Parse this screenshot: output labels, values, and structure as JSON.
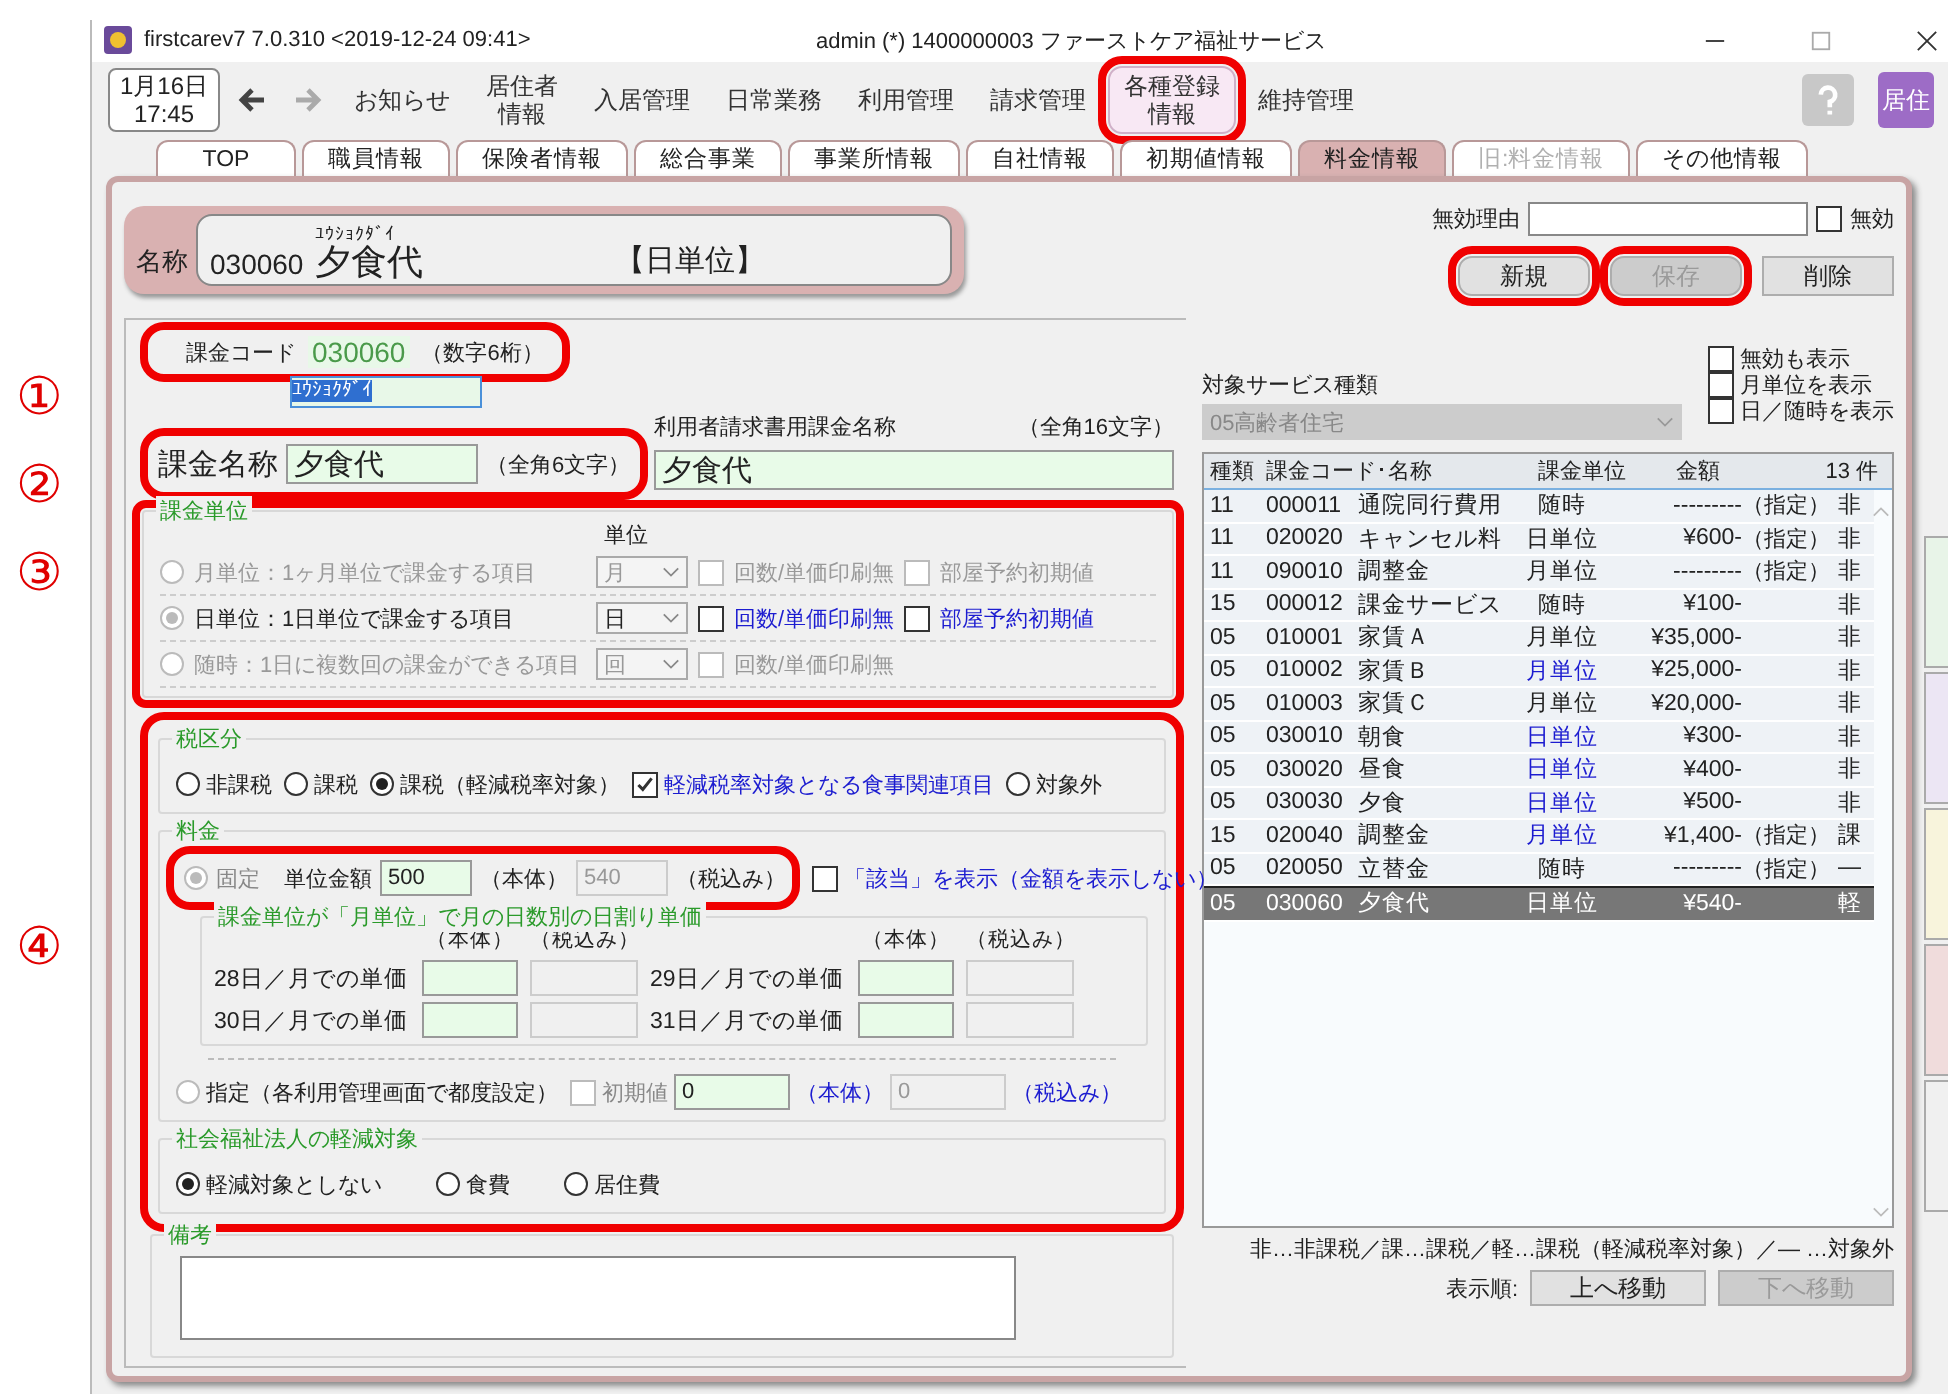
{
  "window": {
    "title": "firstcarev7 7.0.310 <2019-12-24 09:41>",
    "account": "admin (*) 1400000003 ファーストケア福祉サービス"
  },
  "date": {
    "day": "1月16日",
    "time": "17:45"
  },
  "nav": [
    {
      "label": "お知らせ",
      "selected": false
    },
    {
      "lines": [
        "居住者",
        "情報"
      ],
      "selected": false
    },
    {
      "label": "入居管理",
      "selected": false
    },
    {
      "label": "日常業務",
      "selected": false
    },
    {
      "label": "利用管理",
      "selected": false
    },
    {
      "label": "請求管理",
      "selected": false
    },
    {
      "lines": [
        "各種登録",
        "情報"
      ],
      "selected": true,
      "highlighted": true
    },
    {
      "label": "維持管理",
      "selected": false
    }
  ],
  "nav_side_button": "居住",
  "tabs": [
    {
      "label": "TOP",
      "selected": false,
      "disabled": false
    },
    {
      "label": "職員情報",
      "selected": false,
      "disabled": false
    },
    {
      "label": "保険者情報",
      "selected": false,
      "disabled": false
    },
    {
      "label": "総合事業",
      "selected": false,
      "disabled": false
    },
    {
      "label": "事業所情報",
      "selected": false,
      "disabled": false
    },
    {
      "label": "自社情報",
      "selected": false,
      "disabled": false
    },
    {
      "label": "初期値情報",
      "selected": false,
      "disabled": false
    },
    {
      "label": "料金情報",
      "selected": true,
      "disabled": false
    },
    {
      "label": "旧:料金情報",
      "selected": false,
      "disabled": true
    },
    {
      "label": "その他情報",
      "selected": false,
      "disabled": false
    }
  ],
  "annotations": [
    "①",
    "②",
    "③",
    "④"
  ],
  "header": {
    "label": "名称",
    "code": "030060",
    "kana": "ﾕｳｼｮｸﾀﾞｲ",
    "name": "夕食代",
    "unit": "【日単位】"
  },
  "invalid": {
    "label": "無効理由",
    "check_label": "無効",
    "checked": false
  },
  "buttons": [
    {
      "label": "新規",
      "disabled": false,
      "highlighted": true
    },
    {
      "label": "保存",
      "disabled": true,
      "highlighted": true
    },
    {
      "label": "削除",
      "disabled": false,
      "highlighted": false
    }
  ],
  "code_row": {
    "label": "課金コード",
    "value": "030060",
    "hint": "（数字6桁）",
    "highlighted": true
  },
  "kana_field": "ﾕｳｼｮｸﾀﾞｲ",
  "name_row": {
    "label": "課金名称",
    "value": "夕食代",
    "hint": "（全角6文字）",
    "highlighted": true
  },
  "invoice_name": {
    "label": "利用者請求書用課金名称",
    "hint": "（全角16文字）",
    "value": "夕食代"
  },
  "billing_unit": {
    "title": "課金単位",
    "column": "単位",
    "highlighted": true,
    "rows": [
      {
        "label": "月単位：1ヶ月単位で課金する項目",
        "selected": false,
        "disabled": true,
        "unit": "月",
        "print_label": "回数/単価印刷無",
        "print_checked": false,
        "room_label": "部屋予約初期値",
        "room_checked": false
      },
      {
        "label": "日単位：1日単位で課金する項目",
        "selected": true,
        "disabled": false,
        "unit": "日",
        "print_label": "回数/単価印刷無",
        "print_checked": false,
        "room_label": "部屋予約初期値",
        "room_checked": false
      },
      {
        "label": "随時：1日に複数回の課金ができる項目",
        "selected": false,
        "disabled": true,
        "unit": "回",
        "print_label": "回数/単価印刷無",
        "print_checked": false
      }
    ]
  },
  "pricing_highlighted": true,
  "tax": {
    "title": "税区分",
    "options": [
      {
        "kind": "radio",
        "label": "非課税",
        "selected": false
      },
      {
        "kind": "radio",
        "label": "課税",
        "selected": false
      },
      {
        "kind": "radio",
        "label": "課税（軽減税率対象）",
        "selected": true
      },
      {
        "kind": "checkbox",
        "label": "軽減税率対象となる食事関連項目",
        "checked": true
      },
      {
        "kind": "radio",
        "label": "対象外",
        "selected": false
      }
    ]
  },
  "fee": {
    "title": "料金",
    "fixed": {
      "label": "固定",
      "selected": true,
      "unit_label": "単位金額",
      "value": "500",
      "body": "（本体）",
      "tax_value": "540",
      "tax_in": "（税込み）",
      "highlighted": true
    },
    "show_applicable": {
      "label": "「該当」を表示（金額を表示しない）",
      "checked": false
    },
    "daily": {
      "title": "課金単位が「月単位」で月の日数別の日割り単価",
      "headers": [
        "（本体）",
        "（税込み）",
        "（本体）",
        "（税込み）"
      ],
      "rows": [
        "28日／月での単価",
        "29日／月での単価",
        "30日／月での単価",
        "31日／月での単価"
      ]
    },
    "designated": {
      "label": "指定（各利用管理画面で都度設定）",
      "selected": false,
      "initial_label": "初期値",
      "initial_checked": false,
      "body_value": "0",
      "body": "（本体）",
      "tax_value": "0",
      "tax_in": "（税込み）"
    }
  },
  "reduction": {
    "title": "社会福祉法人の軽減対象",
    "options": [
      {
        "label": "軽減対象としない",
        "selected": true
      },
      {
        "label": "食費",
        "selected": false
      },
      {
        "label": "居住費",
        "selected": false
      }
    ]
  },
  "remarks": {
    "title": "備考"
  },
  "service": {
    "label": "対象サービス種類",
    "value": "05高齢者住宅",
    "filters": [
      {
        "label": "無効も表示",
        "checked": false
      },
      {
        "label": "月単位を表示",
        "checked": false
      },
      {
        "label": "日／随時を表示",
        "checked": false
      }
    ]
  },
  "table": {
    "columns": [
      "種類",
      "課金コード･名称",
      "課金単位",
      "金額"
    ],
    "count": "13 件",
    "rows": [
      {
        "type": "11",
        "code": "000011",
        "name": "通院同行費用",
        "unit": "随時",
        "unit_marked": false,
        "amount": "---------",
        "designated": "（指定）",
        "tax": "非",
        "selected": false
      },
      {
        "type": "11",
        "code": "020020",
        "name": "キャンセル料",
        "unit": "日単位",
        "unit_marked": false,
        "amount": "¥600-",
        "designated": "（指定）",
        "tax": "非",
        "selected": false
      },
      {
        "type": "11",
        "code": "090010",
        "name": "調整金",
        "unit": "月単位",
        "unit_marked": false,
        "amount": "---------",
        "designated": "（指定）",
        "tax": "非",
        "selected": false
      },
      {
        "type": "15",
        "code": "000012",
        "name": "課金サービス",
        "unit": "随時",
        "unit_marked": false,
        "amount": "¥100-",
        "tax": "非",
        "selected": false
      },
      {
        "type": "05",
        "code": "010001",
        "name": "家賃Ａ",
        "unit": "月単位",
        "unit_marked": false,
        "amount": "¥35,000-",
        "tax": "非",
        "selected": false
      },
      {
        "type": "05",
        "code": "010002",
        "name": "家賃Ｂ",
        "unit": "月単位",
        "unit_marked": true,
        "amount": "¥25,000-",
        "tax": "非",
        "selected": false
      },
      {
        "type": "05",
        "code": "010003",
        "name": "家賃Ｃ",
        "unit": "月単位",
        "unit_marked": false,
        "amount": "¥20,000-",
        "tax": "非",
        "selected": false
      },
      {
        "type": "05",
        "code": "030010",
        "name": "朝食",
        "unit": "日単位",
        "unit_marked": true,
        "amount": "¥300-",
        "tax": "非",
        "selected": false
      },
      {
        "type": "05",
        "code": "030020",
        "name": "昼食",
        "unit": "日単位",
        "unit_marked": true,
        "amount": "¥400-",
        "tax": "非",
        "selected": false
      },
      {
        "type": "05",
        "code": "030030",
        "name": "夕食",
        "unit": "日単位",
        "unit_marked": true,
        "amount": "¥500-",
        "tax": "非",
        "selected": false
      },
      {
        "type": "15",
        "code": "020040",
        "name": "調整金",
        "unit": "月単位",
        "unit_marked": true,
        "amount": "¥1,400-",
        "designated": "（指定）",
        "tax": "課",
        "selected": false
      },
      {
        "type": "05",
        "code": "020050",
        "name": "立替金",
        "unit": "随時",
        "unit_marked": false,
        "amount": "---------",
        "designated": "（指定）",
        "tax": "―",
        "selected": false
      },
      {
        "type": "05",
        "code": "030060",
        "name": "夕食代",
        "unit": "日単位",
        "unit_marked": false,
        "amount": "¥540-",
        "tax": "軽",
        "selected": true
      }
    ]
  },
  "legend": "非…非課税／課…課税／軽…課税（軽減税率対象）／― …対象外",
  "order": {
    "label": "表示順:",
    "buttons": [
      {
        "label": "上へ移動",
        "disabled": false
      },
      {
        "label": "下へ移動",
        "disabled": true
      }
    ]
  }
}
